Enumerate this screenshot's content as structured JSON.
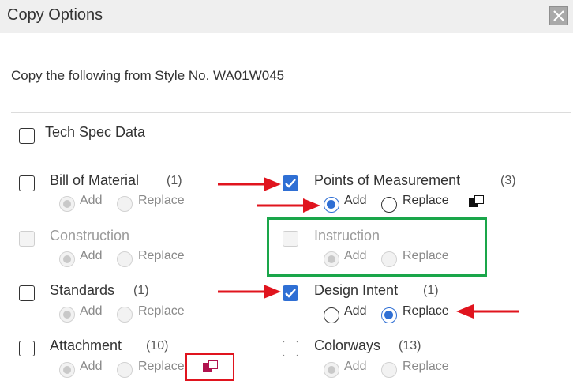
{
  "dialog": {
    "title": "Copy Options",
    "close_icon": "close-icon",
    "subtitle": "Copy the following from Style No. WA01W045"
  },
  "tech_spec": {
    "label": "Tech Spec Data",
    "checked": false
  },
  "radio_labels": {
    "add": "Add",
    "replace": "Replace"
  },
  "items": {
    "bill_of_material": {
      "label": "Bill of Material",
      "count": "(1)",
      "checked": false,
      "enabled": true,
      "selected": "none"
    },
    "points_of_measurement": {
      "label": "Points of Measurement",
      "count": "(3)",
      "checked": true,
      "enabled": true,
      "selected": "add"
    },
    "construction": {
      "label": "Construction",
      "count": "",
      "checked": false,
      "enabled": false,
      "selected": "none"
    },
    "instruction": {
      "label": "Instruction",
      "count": "",
      "checked": false,
      "enabled": false,
      "selected": "none"
    },
    "standards": {
      "label": "Standards",
      "count": "(1)",
      "checked": false,
      "enabled": true,
      "selected": "none"
    },
    "design_intent": {
      "label": "Design Intent",
      "count": "(1)",
      "checked": true,
      "enabled": true,
      "selected": "replace"
    },
    "attachment": {
      "label": "Attachment",
      "count": "(10)",
      "checked": false,
      "enabled": true,
      "selected": "none"
    },
    "colorways": {
      "label": "Colorways",
      "count": "(13)",
      "checked": false,
      "enabled": true,
      "selected": "none"
    }
  },
  "colors": {
    "accent": "#2f6fd4",
    "annotation_red": "#e0141e",
    "annotation_green": "#1aa64a",
    "attachment_icon": "#b0124e"
  }
}
